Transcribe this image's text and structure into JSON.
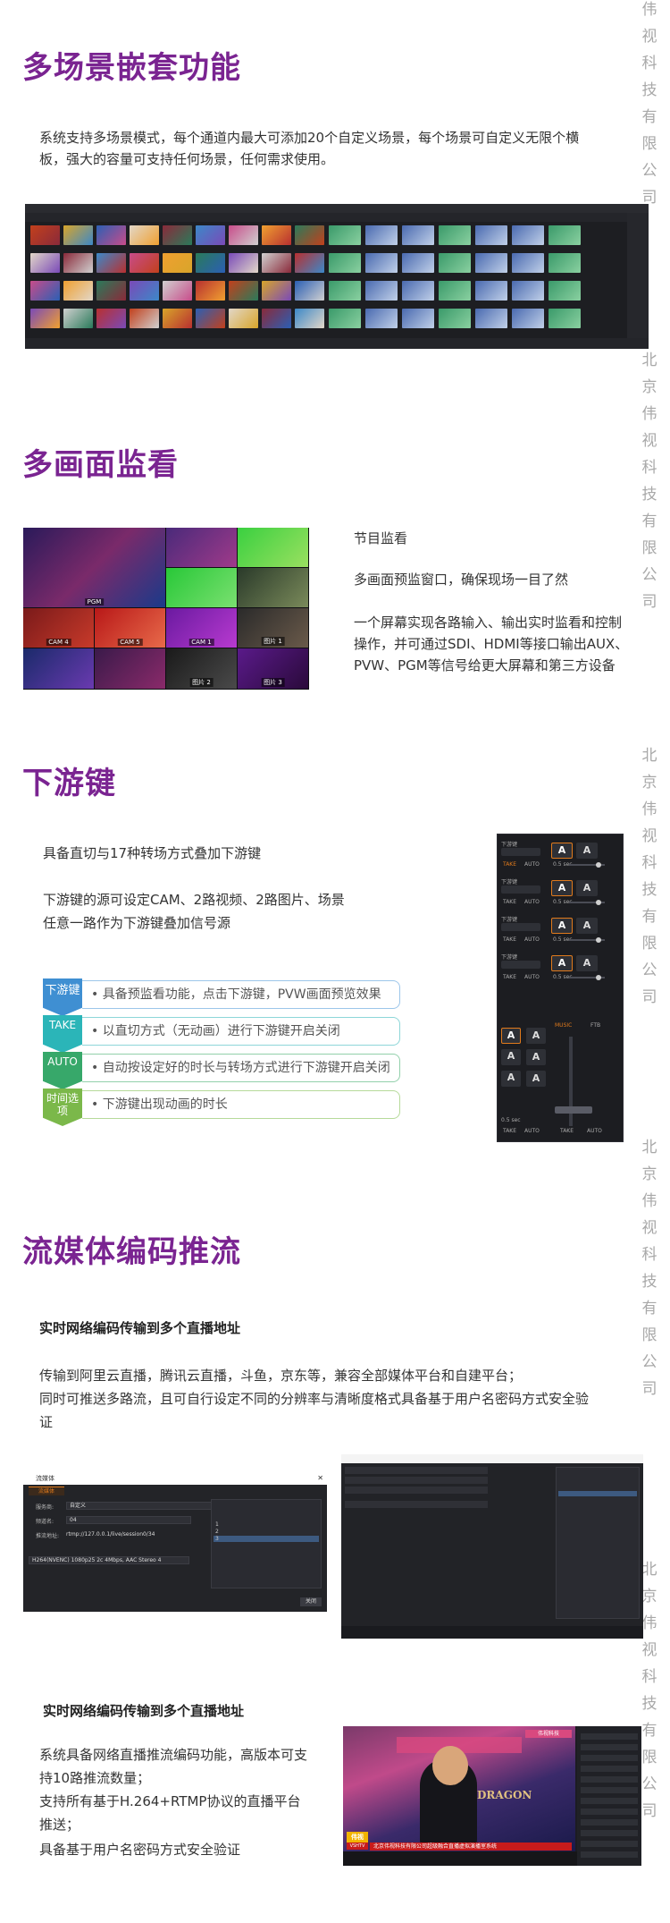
{
  "watermark": [
    "北",
    "京",
    "伟",
    "视",
    "科",
    "技",
    "有",
    "限",
    "公",
    "司"
  ],
  "sections": {
    "s1": {
      "title": "多场景嵌套功能",
      "desc_line1": "系统支持多场景模式，每个通道内最大可添加20个自定义场景，每个场景可自定义无限个横",
      "desc_line2": "板，强大的容量可支持任何场景，任何需求使用。"
    },
    "s2": {
      "title": "多画面监看",
      "line1": "节目监看",
      "line2": "多画面预监窗口，确保现场一目了然",
      "line3": "一个屏幕实现各路输入、输出实时监看和控制",
      "line4": "操作，并可通过SDI、HDMI等接口输出AUX、",
      "line5": "PVW、PGM等信号给更大屏幕和第三方设备",
      "grid_labels": [
        "PGM",
        "CAM 1",
        "CAM 4",
        "CAM 5",
        "图片 1",
        "图片 2",
        "图片 3"
      ]
    },
    "s3": {
      "title": "下游键",
      "line1": "具备直切与17种转场方式叠加下游键",
      "line2": "下游键的源可设定CAM、2路视频、2路图片、场景",
      "line3": "任意一路作为下游键叠加信号源",
      "features": [
        {
          "tag": "下游键",
          "text": "具备预监看功能，点击下游键，PVW画面预览效果",
          "color": "#3f8fd2",
          "border": "#9cc6ea"
        },
        {
          "tag": "TAKE",
          "text": "以直切方式（无动画）进行下游键开启关闭",
          "color": "#2bb5b8",
          "border": "#8dd6d8"
        },
        {
          "tag": "AUTO",
          "text": "自动按设定好的时长与转场方式进行下游键开启关闭",
          "color": "#37a86a",
          "border": "#92d0ab"
        },
        {
          "tag": "时间选项",
          "text": "下游键出现动画的时长",
          "color": "#7bb84a",
          "border": "#b6da9a"
        }
      ],
      "panel": {
        "dsk_label": "下游键",
        "take": "TAKE",
        "auto": "AUTO",
        "ab": "A",
        "fade": "0.5 sec",
        "ftb": "FTB",
        "audio": "MUSIC"
      }
    },
    "s4": {
      "title": "流媒体编码推流",
      "sub1": "实时网络编码传输到多个直播地址",
      "para1_line1": "传输到阿里云直播，腾讯云直播，斗鱼，京东等，兼容全部媒体平台和自建平台；",
      "para1_line2": "同时可推送多路流，且可自行设定不同的分辨率与清晰度格式具备基于用户名密码方式安全验",
      "para1_line3": "证",
      "dialog": {
        "title": "流媒体",
        "tab": "流媒体",
        "server_label": "服务商:",
        "server_value": "自定义",
        "channel_label": "频道名:",
        "channel_value": "04",
        "url_label": "推流地址:",
        "url_value": "rtmp://127.0.0.1/live/session0/34",
        "codec_value": "H264(NVENC) 1080p25 2c 4Mbps, AAC Stereo 4",
        "list": [
          "1",
          "2",
          "3"
        ],
        "close": "关闭"
      },
      "sub2": "实时网络编码传输到多个直播地址",
      "para2_line1": "系统具备网络直播推流编码功能，高版本可支",
      "para2_line2": "持10路推流数量；",
      "para2_line3": "支持所有基于H.264+RTMP协议的直播平台",
      "para2_line4": "推送；",
      "para2_line5": "具备基于用户名密码方式安全验证",
      "studio": {
        "logo": "伟视",
        "brand": "VSHTV",
        "ticker": "北京伟视科技有限公司超级融合直播虚拟演播室系统",
        "tag": "伟视科技",
        "show": "DRAGON"
      }
    }
  },
  "colors": {
    "title": "#7a2491",
    "accent": "#e07a1c"
  }
}
